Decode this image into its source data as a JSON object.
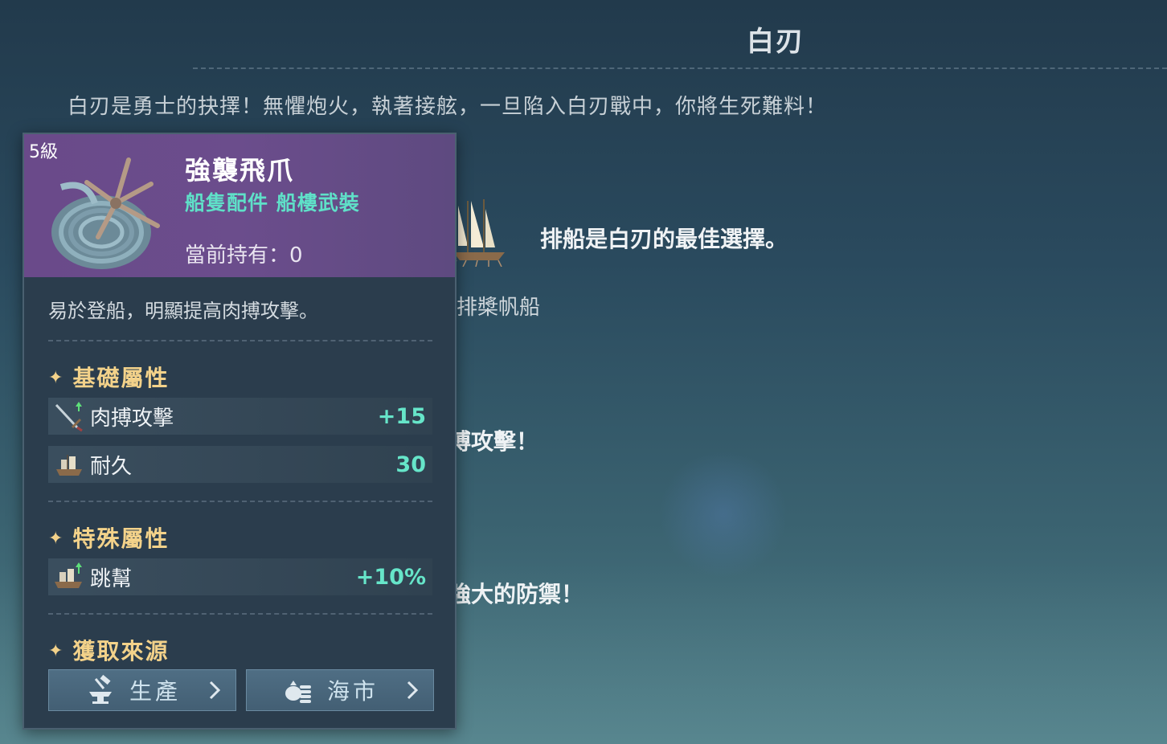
{
  "page": {
    "title": "白刃",
    "intro": "白刃是勇士的抉擇！無懼炮火，執著接舷，一旦陷入白刃戰中，你將生死難料！",
    "ship_label": "排槳帆船",
    "ship_desc": "排船是白刃的最佳選擇。",
    "bg_text_1": "搏攻擊！",
    "bg_text_2": "強大的防禦！"
  },
  "item": {
    "level": "5級",
    "name": "強襲飛爪",
    "type": "船隻配件 船樓武裝",
    "owned": "當前持有：0",
    "description": "易於登船，明顯提高肉搏攻擊。",
    "base_section": "基礎屬性",
    "base_stats": [
      {
        "icon": "sword-icon",
        "name": "肉搏攻擊",
        "value": "+15"
      },
      {
        "icon": "ship-icon",
        "name": "耐久",
        "value": "30"
      }
    ],
    "special_section": "特殊屬性",
    "special_stats": [
      {
        "icon": "ship-icon",
        "name": "跳幫",
        "value": "+10%"
      }
    ],
    "source_section": "獲取來源",
    "sources": [
      {
        "icon": "anvil-icon",
        "label": "生產"
      },
      {
        "icon": "coins-icon",
        "label": "海市"
      }
    ]
  },
  "colors": {
    "header_purple": "#6a4a8a",
    "type_teal": "#5fe0c8",
    "section_gold": "#f3d28a",
    "value_teal": "#66e5c9"
  }
}
